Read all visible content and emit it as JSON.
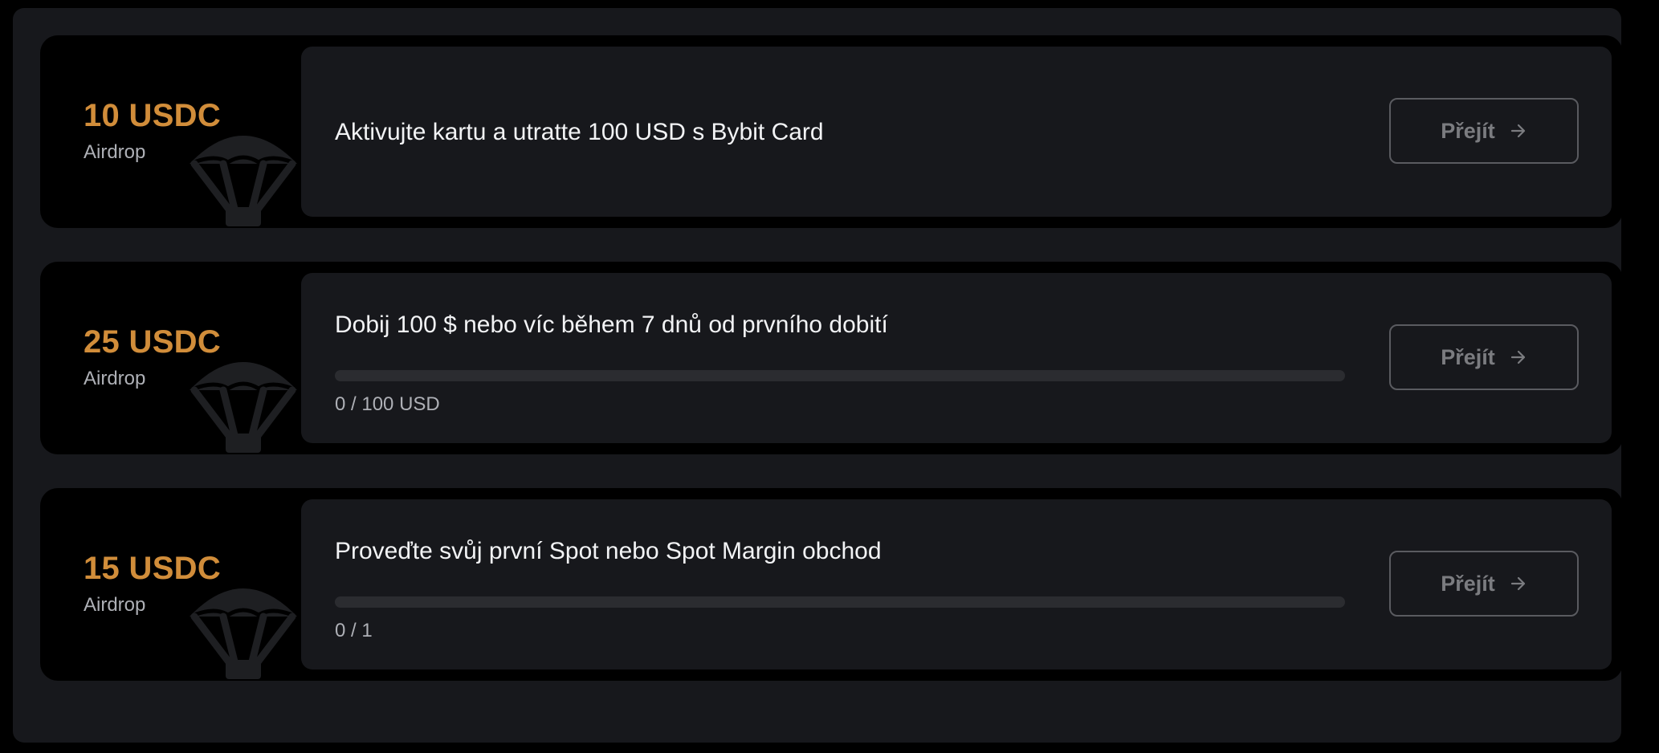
{
  "colors": {
    "accent": "#d18d3a",
    "panel": "#17181c",
    "card": "#000000",
    "text_primary": "#f2f3f5",
    "text_muted": "#aeb0b6",
    "button_border": "#5a5b60",
    "button_text": "#7b7c80"
  },
  "tasks": [
    {
      "reward_amount": "10 USDC",
      "reward_type": "Airdrop",
      "reward_icon": "parachute-icon",
      "title": "Aktivujte kartu a utratte 100 USD s Bybit Card",
      "button_label": "Přejít",
      "button_icon": "arrow-right-icon"
    },
    {
      "reward_amount": "25 USDC",
      "reward_type": "Airdrop",
      "reward_icon": "parachute-icon",
      "title": "Dobij 100 $ nebo víc během 7 dnů od prvního dobití",
      "progress_fraction": 0,
      "progress_text": "0 / 100 USD",
      "button_label": "Přejít",
      "button_icon": "arrow-right-icon"
    },
    {
      "reward_amount": "15 USDC",
      "reward_type": "Airdrop",
      "reward_icon": "parachute-icon",
      "title": "Proveďte svůj první Spot nebo Spot Margin obchod",
      "progress_fraction": 0,
      "progress_text": "0 / 1",
      "button_label": "Přejít",
      "button_icon": "arrow-right-icon"
    }
  ]
}
